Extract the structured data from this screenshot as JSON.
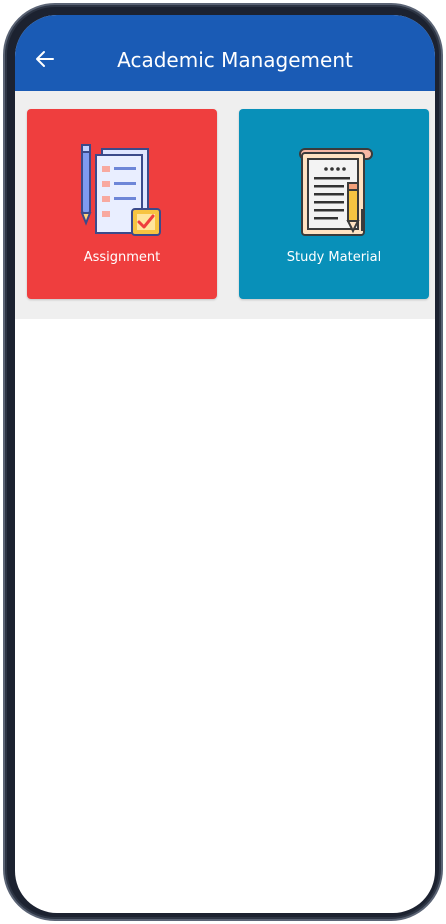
{
  "header": {
    "title": "Academic Management",
    "back_icon": "arrow-left-icon",
    "background_color": "#1a5bb5"
  },
  "tiles": [
    {
      "label": "Assignment",
      "icon": "assignment-checklist-icon",
      "color": "#ef3e3e"
    },
    {
      "label": "Study Material",
      "icon": "notebook-pencil-icon",
      "color": "#0890b9"
    }
  ]
}
